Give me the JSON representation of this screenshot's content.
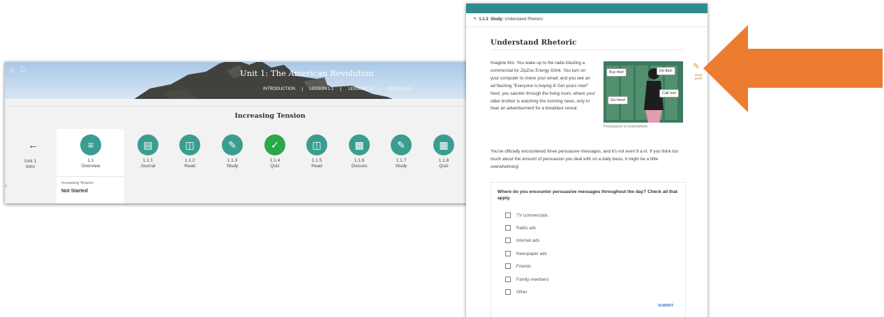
{
  "left_panel": {
    "unit_title": "Unit 1: The American Revolution",
    "nav_tabs": [
      "INTRODUCTION",
      "LESSON 1.1",
      "LESSON 1.2",
      "LESSON 1.3"
    ],
    "lesson_title": "Increasing Tension",
    "back": {
      "line1": "Unit 1",
      "line2": "Intro"
    },
    "activities": [
      {
        "num": "1.1",
        "label": "Overview",
        "icon": "list-icon"
      },
      {
        "num": "1.1.1",
        "label": "Journal",
        "icon": "journal-icon"
      },
      {
        "num": "1.1.2",
        "label": "Read",
        "icon": "book-icon"
      },
      {
        "num": "1.1.3",
        "label": "Study",
        "icon": "pencil-icon"
      },
      {
        "num": "1.1.4",
        "label": "Quiz",
        "icon": "check-icon"
      },
      {
        "num": "1.1.5",
        "label": "Read",
        "icon": "book-icon"
      },
      {
        "num": "1.1.6",
        "label": "Discuss",
        "icon": "chat-icon"
      },
      {
        "num": "1.1.7",
        "label": "Study",
        "icon": "pencil-icon"
      },
      {
        "num": "1.1.8",
        "label": "Quiz",
        "icon": "quiz-icon"
      }
    ],
    "status": {
      "heading": "Increasing Tension",
      "value": "Not Started"
    }
  },
  "right_panel": {
    "breadcrumb": {
      "num": "1.1.3",
      "type": "Study:",
      "title": "Understand Rhetoric"
    },
    "page_title": "Understand Rhetoric",
    "intro_text": "Imagine this: You wake up to the radio blasting a commercial for ZipZoo Energy Drink. You turn on your computer to check your email, and you see an ad flashing \"Everyone is buying it! Get yours now!\" Next, you saunter through the living room, where your older brother is watching the morning news, only to hear an advertisement for a breakfast cereal.",
    "illustration": {
      "bubbles": [
        "Buy this!",
        "Do this!",
        "Call me!",
        "Go here!"
      ],
      "caption": "Persuasion is everywhere."
    },
    "study_guide_label": "Study guide",
    "para2": "You've officially encountered three persuasive messages, and it's not even 9 a.m. If you think too much about the amount of persuasion you deal with on a daily basis, it might be a little overwhelming!",
    "question": "Where do you encounter persuasive messages throughout the day? Check all that apply.",
    "options": [
      "TV commercials",
      "Radio ads",
      "Internet ads",
      "Newspaper ads",
      "Friends",
      "Family members",
      "Other"
    ],
    "submit_label": "SUBMIT"
  },
  "colors": {
    "teal": "#2e8c8e",
    "activity_circle": "#3a9d8f",
    "quiz_done": "#2aa84a",
    "arrow": "#ec7c30",
    "pencil": "#e2a23a"
  }
}
